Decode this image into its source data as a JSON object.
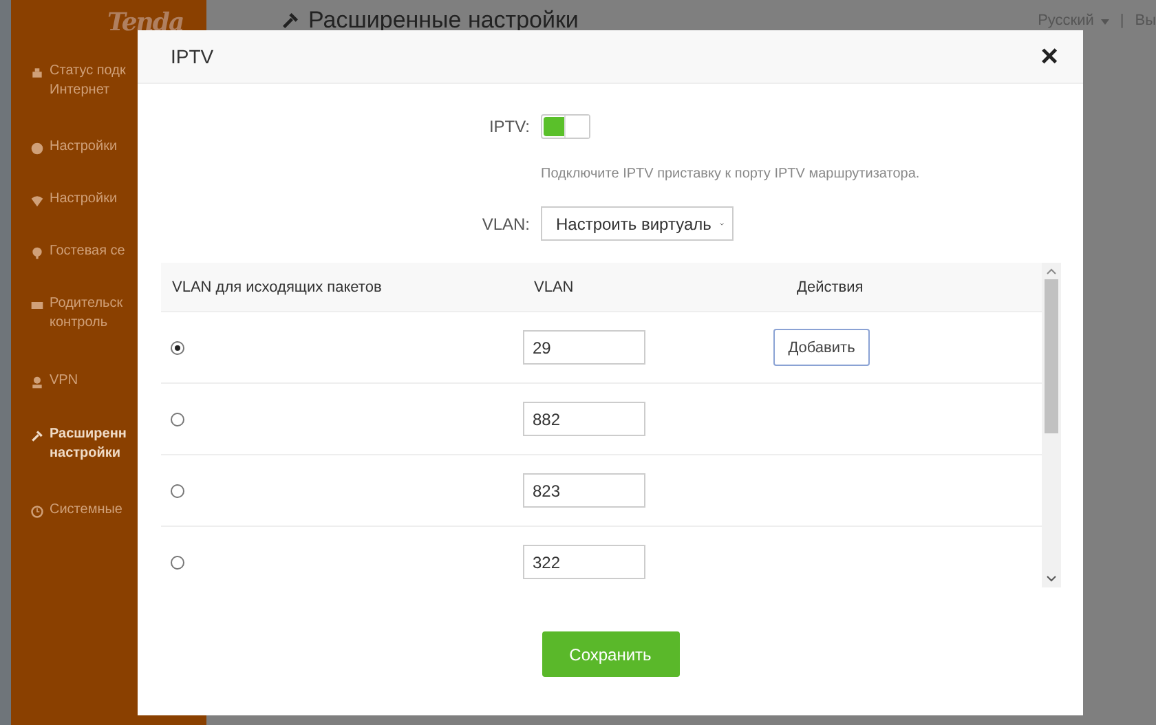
{
  "sidebar": {
    "logo": "Tenda",
    "items": [
      {
        "lines": [
          "Статус подк",
          "Интернет"
        ],
        "selected": false
      },
      {
        "lines": [
          "Настройки"
        ],
        "selected": false
      },
      {
        "lines": [
          "Настройки"
        ],
        "selected": false
      },
      {
        "lines": [
          "Гостевая се"
        ],
        "selected": false
      },
      {
        "lines": [
          "Родительск",
          "контроль"
        ],
        "selected": false
      },
      {
        "lines": [
          "VPN"
        ],
        "selected": false
      },
      {
        "lines": [
          "Расширенн",
          "настройки"
        ],
        "selected": true
      },
      {
        "lines": [
          "Системные"
        ],
        "selected": false
      }
    ]
  },
  "header": {
    "title": "Расширенные настройки",
    "language": "Русский",
    "separator": "|",
    "logout": "Вы"
  },
  "dialog": {
    "title": "IPTV",
    "close": "×",
    "iptv": {
      "label": "IPTV:",
      "on": true
    },
    "hint": "Подключите IPTV приставку к порту IPTV маршрутизатора.",
    "vlan": {
      "label": "VLAN:",
      "value": "Настроить виртуаль"
    },
    "table": {
      "columns": [
        "VLAN для исходящих пакетов",
        "VLAN",
        "Действия"
      ],
      "rows": [
        {
          "selected": true,
          "vlan": "29",
          "action": "Добавить"
        },
        {
          "selected": false,
          "vlan": "882"
        },
        {
          "selected": false,
          "vlan": "823"
        },
        {
          "selected": false,
          "vlan": "322"
        }
      ]
    },
    "save": "Сохранить"
  }
}
